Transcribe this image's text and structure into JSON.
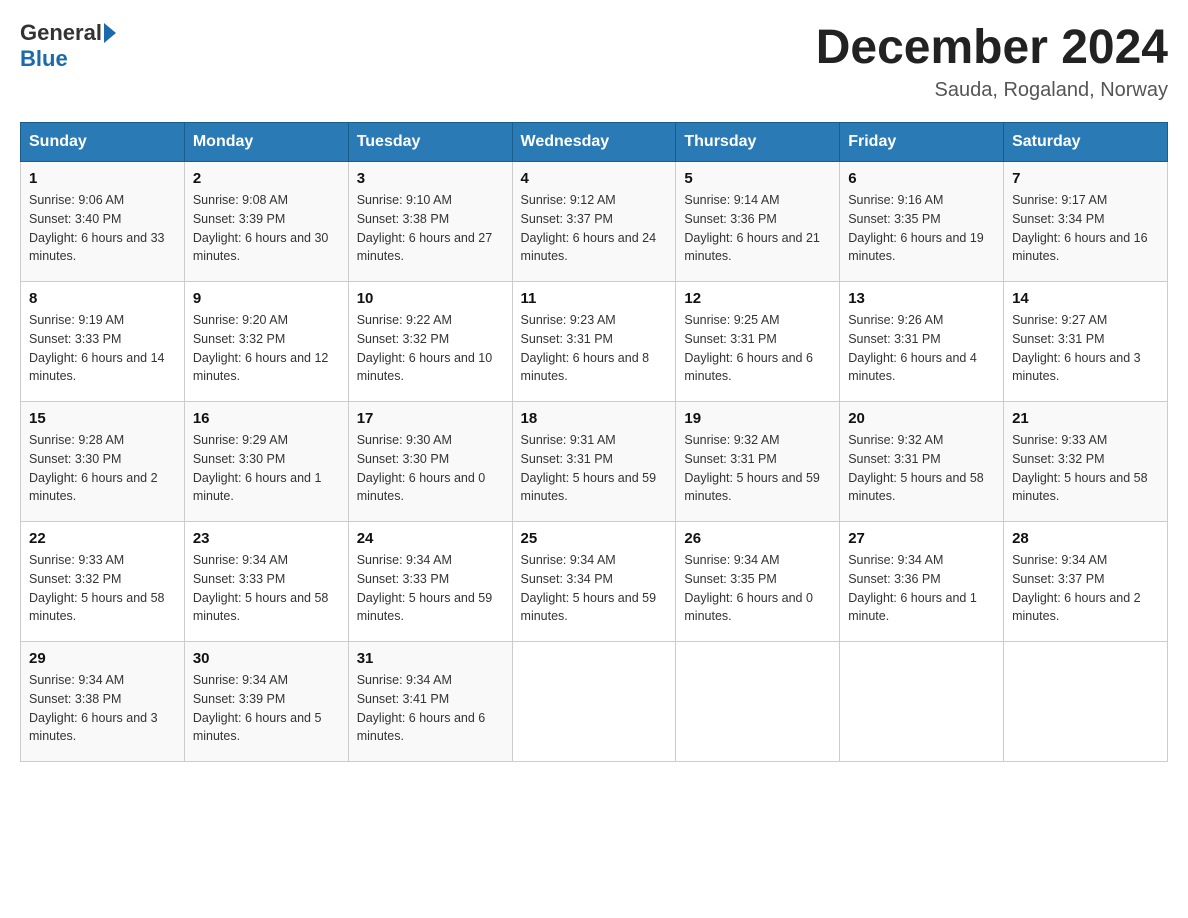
{
  "header": {
    "logo_general": "General",
    "logo_blue": "Blue",
    "month_title": "December 2024",
    "location": "Sauda, Rogaland, Norway"
  },
  "days_of_week": [
    "Sunday",
    "Monday",
    "Tuesday",
    "Wednesday",
    "Thursday",
    "Friday",
    "Saturday"
  ],
  "weeks": [
    [
      {
        "day": "1",
        "sunrise": "9:06 AM",
        "sunset": "3:40 PM",
        "daylight": "6 hours and 33 minutes."
      },
      {
        "day": "2",
        "sunrise": "9:08 AM",
        "sunset": "3:39 PM",
        "daylight": "6 hours and 30 minutes."
      },
      {
        "day": "3",
        "sunrise": "9:10 AM",
        "sunset": "3:38 PM",
        "daylight": "6 hours and 27 minutes."
      },
      {
        "day": "4",
        "sunrise": "9:12 AM",
        "sunset": "3:37 PM",
        "daylight": "6 hours and 24 minutes."
      },
      {
        "day": "5",
        "sunrise": "9:14 AM",
        "sunset": "3:36 PM",
        "daylight": "6 hours and 21 minutes."
      },
      {
        "day": "6",
        "sunrise": "9:16 AM",
        "sunset": "3:35 PM",
        "daylight": "6 hours and 19 minutes."
      },
      {
        "day": "7",
        "sunrise": "9:17 AM",
        "sunset": "3:34 PM",
        "daylight": "6 hours and 16 minutes."
      }
    ],
    [
      {
        "day": "8",
        "sunrise": "9:19 AM",
        "sunset": "3:33 PM",
        "daylight": "6 hours and 14 minutes."
      },
      {
        "day": "9",
        "sunrise": "9:20 AM",
        "sunset": "3:32 PM",
        "daylight": "6 hours and 12 minutes."
      },
      {
        "day": "10",
        "sunrise": "9:22 AM",
        "sunset": "3:32 PM",
        "daylight": "6 hours and 10 minutes."
      },
      {
        "day": "11",
        "sunrise": "9:23 AM",
        "sunset": "3:31 PM",
        "daylight": "6 hours and 8 minutes."
      },
      {
        "day": "12",
        "sunrise": "9:25 AM",
        "sunset": "3:31 PM",
        "daylight": "6 hours and 6 minutes."
      },
      {
        "day": "13",
        "sunrise": "9:26 AM",
        "sunset": "3:31 PM",
        "daylight": "6 hours and 4 minutes."
      },
      {
        "day": "14",
        "sunrise": "9:27 AM",
        "sunset": "3:31 PM",
        "daylight": "6 hours and 3 minutes."
      }
    ],
    [
      {
        "day": "15",
        "sunrise": "9:28 AM",
        "sunset": "3:30 PM",
        "daylight": "6 hours and 2 minutes."
      },
      {
        "day": "16",
        "sunrise": "9:29 AM",
        "sunset": "3:30 PM",
        "daylight": "6 hours and 1 minute."
      },
      {
        "day": "17",
        "sunrise": "9:30 AM",
        "sunset": "3:30 PM",
        "daylight": "6 hours and 0 minutes."
      },
      {
        "day": "18",
        "sunrise": "9:31 AM",
        "sunset": "3:31 PM",
        "daylight": "5 hours and 59 minutes."
      },
      {
        "day": "19",
        "sunrise": "9:32 AM",
        "sunset": "3:31 PM",
        "daylight": "5 hours and 59 minutes."
      },
      {
        "day": "20",
        "sunrise": "9:32 AM",
        "sunset": "3:31 PM",
        "daylight": "5 hours and 58 minutes."
      },
      {
        "day": "21",
        "sunrise": "9:33 AM",
        "sunset": "3:32 PM",
        "daylight": "5 hours and 58 minutes."
      }
    ],
    [
      {
        "day": "22",
        "sunrise": "9:33 AM",
        "sunset": "3:32 PM",
        "daylight": "5 hours and 58 minutes."
      },
      {
        "day": "23",
        "sunrise": "9:34 AM",
        "sunset": "3:33 PM",
        "daylight": "5 hours and 58 minutes."
      },
      {
        "day": "24",
        "sunrise": "9:34 AM",
        "sunset": "3:33 PM",
        "daylight": "5 hours and 59 minutes."
      },
      {
        "day": "25",
        "sunrise": "9:34 AM",
        "sunset": "3:34 PM",
        "daylight": "5 hours and 59 minutes."
      },
      {
        "day": "26",
        "sunrise": "9:34 AM",
        "sunset": "3:35 PM",
        "daylight": "6 hours and 0 minutes."
      },
      {
        "day": "27",
        "sunrise": "9:34 AM",
        "sunset": "3:36 PM",
        "daylight": "6 hours and 1 minute."
      },
      {
        "day": "28",
        "sunrise": "9:34 AM",
        "sunset": "3:37 PM",
        "daylight": "6 hours and 2 minutes."
      }
    ],
    [
      {
        "day": "29",
        "sunrise": "9:34 AM",
        "sunset": "3:38 PM",
        "daylight": "6 hours and 3 minutes."
      },
      {
        "day": "30",
        "sunrise": "9:34 AM",
        "sunset": "3:39 PM",
        "daylight": "6 hours and 5 minutes."
      },
      {
        "day": "31",
        "sunrise": "9:34 AM",
        "sunset": "3:41 PM",
        "daylight": "6 hours and 6 minutes."
      },
      null,
      null,
      null,
      null
    ]
  ]
}
